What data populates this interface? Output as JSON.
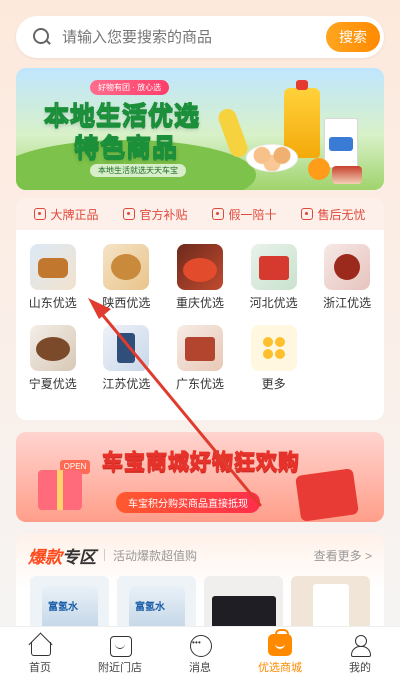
{
  "search": {
    "placeholder": "请输入您要搜索的商品",
    "button": "搜索"
  },
  "banner": {
    "tag": "好物有团 · 放心选",
    "title_line1": "本地生活优选",
    "title_line2": "特色商品",
    "subtitle": "本地生活就选天天车宝"
  },
  "guarantees": [
    {
      "label": "大牌正品"
    },
    {
      "label": "官方补贴"
    },
    {
      "label": "假一陪十"
    },
    {
      "label": "售后无忧"
    }
  ],
  "categories": [
    {
      "label": "山东优选"
    },
    {
      "label": "陕西优选"
    },
    {
      "label": "重庆优选"
    },
    {
      "label": "河北优选"
    },
    {
      "label": "浙江优选"
    },
    {
      "label": "宁夏优选"
    },
    {
      "label": "江苏优选"
    },
    {
      "label": "广东优选"
    },
    {
      "label": "更多"
    }
  ],
  "promo": {
    "open_tag": "OPEN",
    "title": "车宝商城好物狂欢购",
    "subtitle": "车宝积分购买商品直接抵现"
  },
  "hot_zone": {
    "title_accent": "爆款",
    "title_rest": "专区",
    "subtitle": "活动爆款超值购",
    "more": "查看更多 >"
  },
  "tabbar": [
    {
      "label": "首页",
      "icon": "home-icon"
    },
    {
      "label": "附近门店",
      "icon": "store-icon"
    },
    {
      "label": "消息",
      "icon": "message-icon"
    },
    {
      "label": "优选商城",
      "icon": "shop-icon",
      "active": true
    },
    {
      "label": "我的",
      "icon": "profile-icon"
    }
  ],
  "colors": {
    "accent": "#ff8a00",
    "guarantee": "#e0483a",
    "hot": "#ff4a1c",
    "annotation_arrow": "#e03b2e"
  }
}
